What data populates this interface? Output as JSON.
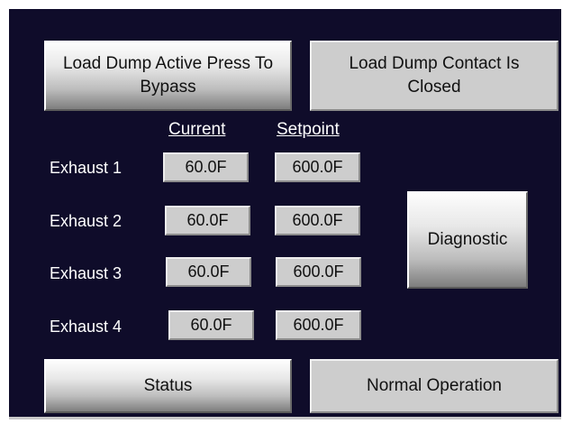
{
  "buttons": {
    "load_dump_bypass": "Load Dump Active Press To Bypass",
    "diagnostic": "Diagnostic",
    "status": "Status"
  },
  "indicators": {
    "load_dump_contact": "Load Dump Contact Is Closed",
    "operation_status": "Normal Operation"
  },
  "table": {
    "headers": {
      "current": "Current",
      "setpoint": "Setpoint"
    },
    "rows": [
      {
        "label": "Exhaust 1",
        "current": "60.0F",
        "setpoint": "600.0F"
      },
      {
        "label": "Exhaust 2",
        "current": "60.0F",
        "setpoint": "600.0F"
      },
      {
        "label": "Exhaust 3",
        "current": "60.0F",
        "setpoint": "600.0F"
      },
      {
        "label": "Exhaust 4",
        "current": "60.0F",
        "setpoint": "600.0F"
      }
    ]
  },
  "colors": {
    "background": "#0f0c2a",
    "panel_grey": "#cdcdcd",
    "text_white": "#ffffff"
  }
}
